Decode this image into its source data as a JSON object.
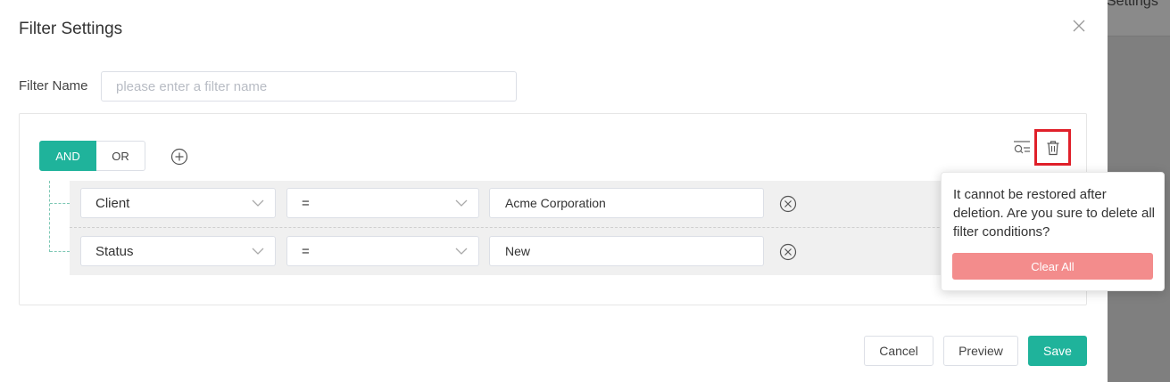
{
  "background": {
    "partial_text": "Settings"
  },
  "dialog": {
    "title": "Filter Settings",
    "filter_name_label": "Filter Name",
    "filter_name_value": "",
    "filter_name_placeholder": "please enter a filter name"
  },
  "logic": {
    "and_label": "AND",
    "or_label": "OR",
    "selected": "AND"
  },
  "conditions": [
    {
      "field": "Client",
      "operator": "=",
      "value": "Acme Corporation"
    },
    {
      "field": "Status",
      "operator": "=",
      "value": "New"
    }
  ],
  "popover": {
    "message": "It cannot be restored after deletion. Are you sure to delete all filter conditions?",
    "confirm_label": "Clear All"
  },
  "footer": {
    "cancel_label": "Cancel",
    "preview_label": "Preview",
    "save_label": "Save"
  },
  "icons": {
    "close": "close-icon",
    "add": "plus-circle-icon",
    "remove": "x-circle-icon",
    "advanced_search": "filter-search-icon",
    "trash": "trash-icon",
    "dropdown": "chevron-down-icon"
  },
  "colors": {
    "accent": "#1fb39b",
    "danger_button": "#f38c8c",
    "highlight_border": "#e0202a",
    "overlay": "#7f7f7f"
  }
}
